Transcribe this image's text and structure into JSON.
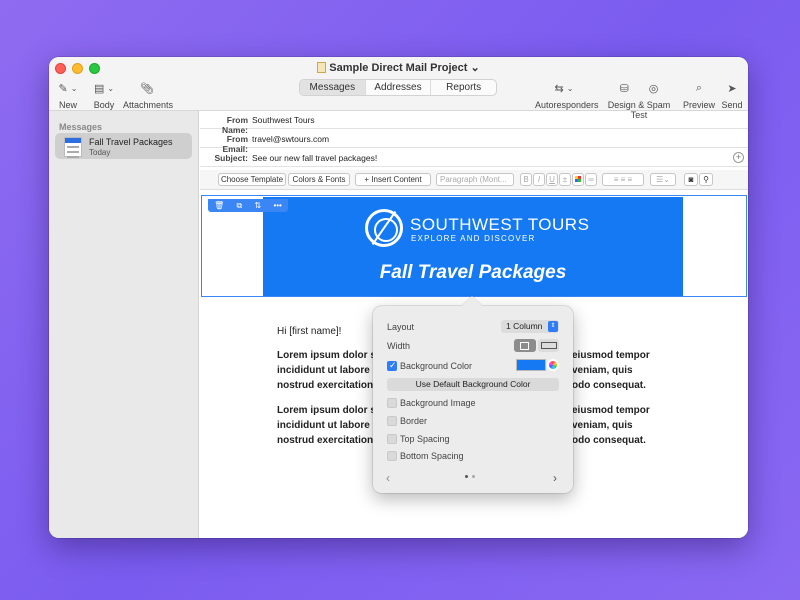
{
  "window": {
    "title": "Sample Direct Mail Project"
  },
  "toolbar": {
    "new_label": "New",
    "body_label": "Body",
    "attachments_label": "Attachments",
    "tabs": [
      "Messages",
      "Addresses",
      "Reports"
    ],
    "active_tab": "Messages",
    "autoresponders_label": "Autoresponders",
    "design_spam_label": "Design & Spam Test",
    "preview_label": "Preview",
    "send_label": "Send"
  },
  "sidebar": {
    "header": "Messages",
    "items": [
      {
        "name": "Fall Travel Packages",
        "date": "Today"
      }
    ]
  },
  "fields": {
    "from_name_label": "From Name:",
    "from_name_value": "Southwest Tours",
    "from_email_label": "From Email:",
    "from_email_value": "travel@swtours.com",
    "subject_label": "Subject:",
    "subject_value": "See our new fall travel packages!"
  },
  "formatbar": {
    "choose_template": "Choose Template",
    "colors_fonts": "Colors & Fonts",
    "insert_content": "+ Insert Content",
    "paragraph": "Paragraph (Mont...",
    "bold": "B",
    "italic": "I",
    "underline": "U"
  },
  "email": {
    "brand_name": "SOUTHWEST TOURS",
    "tagline": "EXPLORE AND DISCOVER",
    "banner_title": "Fall Travel Packages",
    "banner_color": "#1479f2",
    "greeting": "Hi [first name]!",
    "p1_left": [
      "Lorem ipsum dolor s",
      "incididunt ut labore",
      "nostrud exercitation"
    ],
    "p1_right": [
      "eiusmod tempor",
      "veniam, quis",
      "odo consequat."
    ],
    "p2_left": [
      "Lorem ipsum dolor s",
      "incididunt ut labore",
      "nostrud exercitation"
    ],
    "p2_right": [
      "eiusmod tempor",
      "veniam, quis",
      "odo consequat."
    ]
  },
  "popover": {
    "layout_label": "Layout",
    "layout_value": "1 Column",
    "width_label": "Width",
    "background_color_label": "Background Color",
    "background_color_checked": true,
    "use_default_bg_label": "Use Default Background Color",
    "background_image_label": "Background Image",
    "border_label": "Border",
    "top_spacing_label": "Top Spacing",
    "bottom_spacing_label": "Bottom Spacing",
    "accent_color": "#2f7df6"
  }
}
